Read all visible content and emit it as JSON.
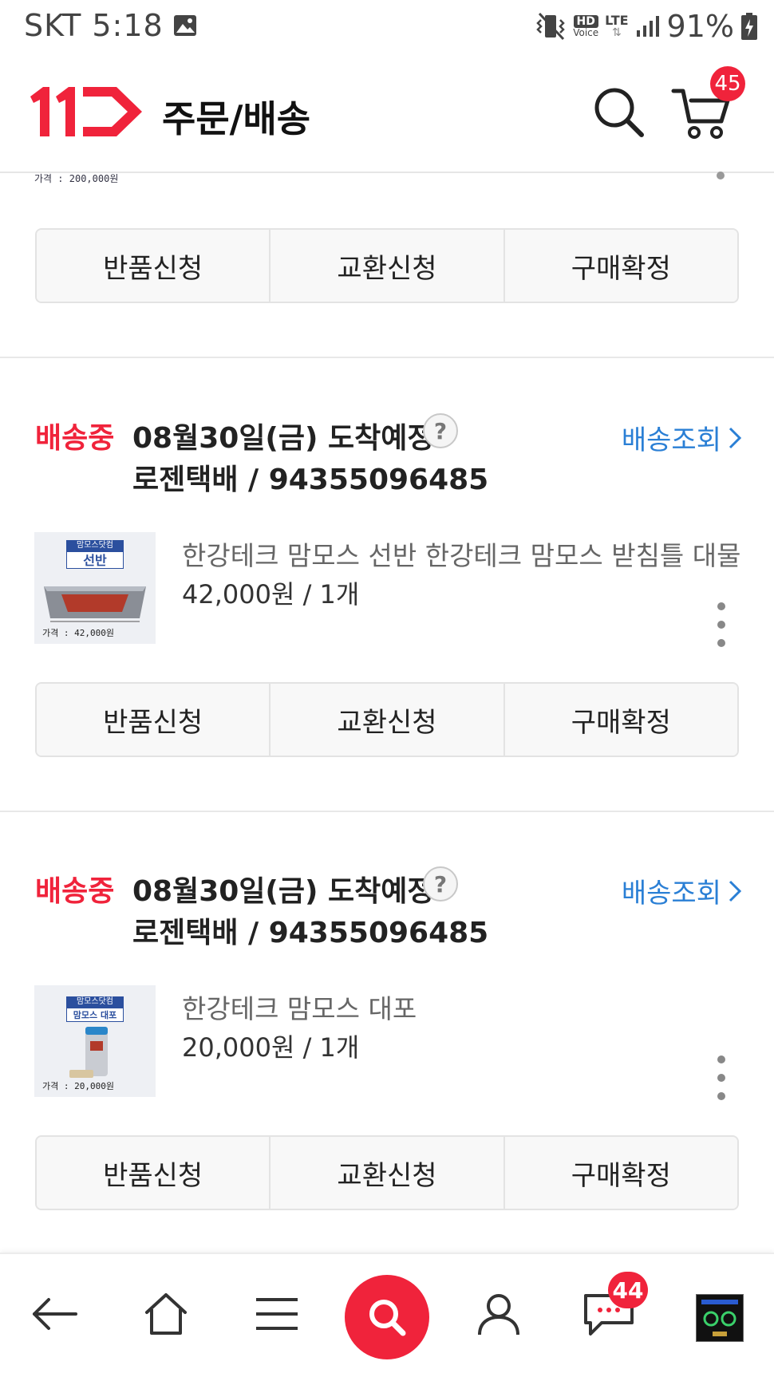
{
  "statusbar": {
    "carrier_time": "SKT 5:18",
    "hd_voice": "HD",
    "voice": "Voice",
    "lte": "LTE",
    "battery": "91%"
  },
  "header": {
    "title": "주문/배송",
    "cart_count": "45",
    "icons": [
      "11st-logo",
      "search-icon",
      "cart-icon"
    ]
  },
  "partial_order": {
    "price_caption": "가격 : 200,000원",
    "actions": [
      "반품신청",
      "교환신청",
      "구매확정"
    ]
  },
  "orders": [
    {
      "status": "배송중",
      "eta": "08월30일(금) 도착예정",
      "help": "?",
      "track_label": "배송조회",
      "courier": "로젠택배 / 94355096485",
      "thumb_tag": "맘모스닷컴",
      "thumb_title": "선반",
      "thumb_price": "가격 : 42,000원",
      "product_name": "한강테크 맘모스 선반 한강테크 맘모스 받침틀 대물",
      "price_qty": "42,000원 / 1개",
      "actions": [
        "반품신청",
        "교환신청",
        "구매확정"
      ]
    },
    {
      "status": "배송중",
      "eta": "08월30일(금) 도착예정",
      "help": "?",
      "track_label": "배송조회",
      "courier": "로젠택배 / 94355096485",
      "thumb_tag": "맘모스닷컴",
      "thumb_title": "맘모스 대포",
      "thumb_price": "가격 : 20,000원",
      "product_name": "한강테크 맘모스 대포",
      "price_qty": "20,000원 / 1개",
      "actions": [
        "반품신청",
        "교환신청",
        "구매확정"
      ]
    }
  ],
  "bottom_nav": {
    "talk_count": "44",
    "items": [
      "back-icon",
      "home-icon",
      "menu-icon",
      "search-icon",
      "my-page-icon",
      "talk-icon",
      "recent-item-thumb"
    ]
  },
  "colors": {
    "accent_red": "#f0233b",
    "link_blue": "#2a7fd5"
  }
}
